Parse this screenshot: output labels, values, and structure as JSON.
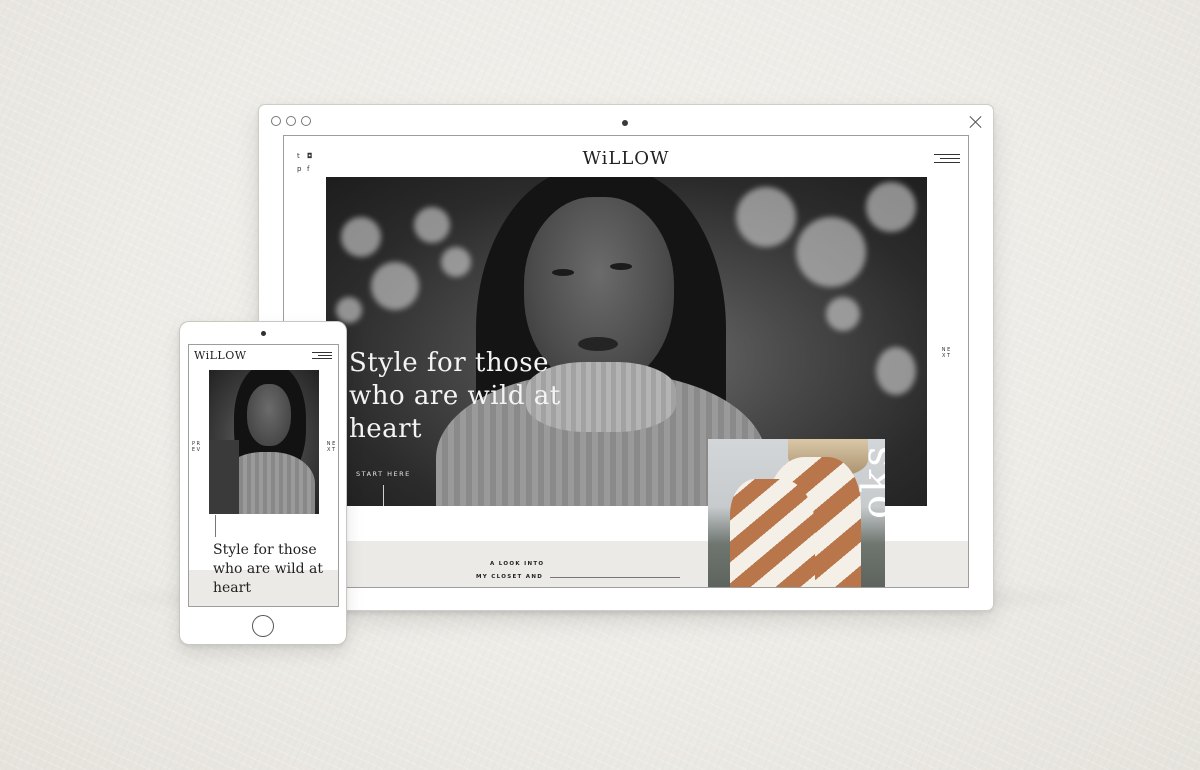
{
  "desktop": {
    "brand": "WiLLOW",
    "social_icons": [
      "twitter-icon",
      "instagram-icon",
      "pinterest-icon",
      "facebook-icon"
    ],
    "social_glyphs": [
      "t",
      "◘",
      "p",
      "f"
    ],
    "hero": {
      "headline": "Style for those who are wild at heart",
      "cta": "START HERE",
      "next_label": "N E X T"
    },
    "band": {
      "line1": "A LOOK INTO",
      "line2": "MY CLOSET AND"
    },
    "lookbook_word": "oks"
  },
  "phone": {
    "brand": "WiLLOW",
    "prev_label": "P R E V",
    "next_label": "N E X T",
    "headline": "Style for those who are wild at heart"
  }
}
